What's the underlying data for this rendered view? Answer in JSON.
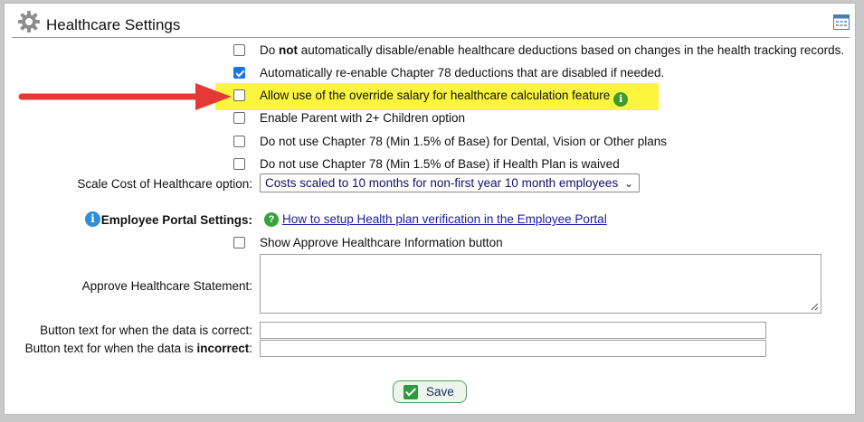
{
  "header": {
    "title": "Healthcare Settings",
    "left_icon": "gear-icon",
    "right_icon": "calendar-icon"
  },
  "options": [
    {
      "prefix": "Do ",
      "bold": "not",
      "suffix": " automatically disable/enable healthcare deductions based on changes in the health tracking records.",
      "checked": false
    },
    {
      "label": "Automatically re-enable Chapter 78 deductions that are disabled if needed.",
      "checked": true
    },
    {
      "label": "Allow use of the override salary for healthcare calculation feature",
      "checked": false,
      "highlighted": true,
      "icon": "info-icon"
    },
    {
      "label": "Enable Parent with 2+ Children option",
      "checked": false
    },
    {
      "label": "Do not use Chapter 78 (Min 1.5% of Base) for Dental, Vision or Other plans",
      "checked": false
    },
    {
      "label": "Do not use Chapter 78 (Min 1.5% of Base) if Health Plan is waived",
      "checked": false
    }
  ],
  "scale_cost": {
    "label": "Scale Cost of Healthcare option:",
    "selected": "Costs scaled to 10 months for non-first year 10 month employees"
  },
  "portal": {
    "label": "Employee Portal Settings:",
    "link": "How to setup Health plan verification in the Employee Portal",
    "show_approve_label": "Show Approve Healthcare Information button",
    "show_approve_checked": false,
    "statement_label": "Approve Healthcare Statement:",
    "statement_value": "",
    "correct_label": "Button text for when the data is correct:",
    "correct_value": "",
    "incorrect_prefix": "Button text for when the data is ",
    "incorrect_bold": "incorrect",
    "incorrect_suffix": ":",
    "incorrect_value": ""
  },
  "save": {
    "label": "Save"
  },
  "colors": {
    "highlight": "#fbf63d",
    "arrow": "#e53935",
    "accent": "#1a73e8"
  }
}
